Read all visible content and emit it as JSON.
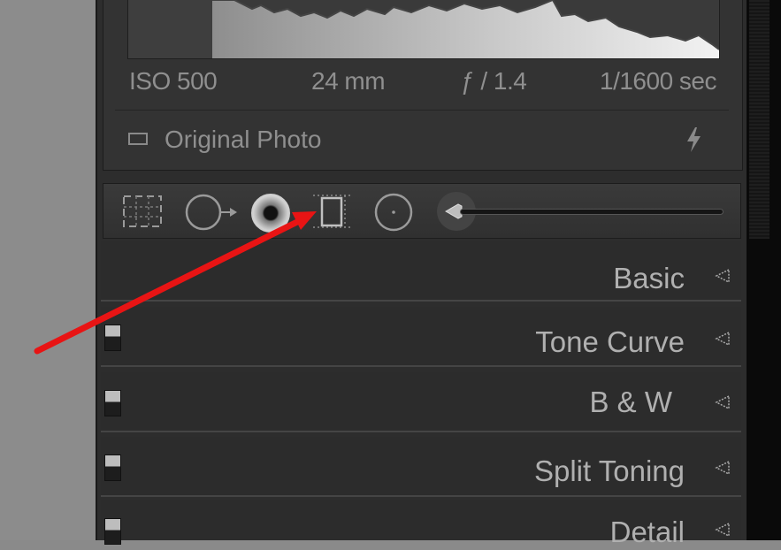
{
  "histogram": {
    "exif": {
      "iso": "ISO 500",
      "focal_length": "24 mm",
      "aperture": "ƒ / 1.4",
      "shutter": "1/1600 sec"
    },
    "original_photo_label": "Original Photo",
    "icons": {
      "original": "rectangle-outline-icon",
      "flash": "lightning-bolt-icon"
    }
  },
  "toolstrip": {
    "tools": [
      {
        "name": "crop-overlay-tool",
        "icon": "crop-grid-icon"
      },
      {
        "name": "spot-removal-tool",
        "icon": "circle-arrow-icon"
      },
      {
        "name": "red-eye-tool",
        "icon": "eye-icon"
      },
      {
        "name": "graduated-filter-tool",
        "icon": "graduated-rectangle-icon"
      },
      {
        "name": "radial-filter-tool",
        "icon": "radial-circle-icon"
      },
      {
        "name": "adjustment-brush-tool",
        "icon": "brush-icon"
      }
    ],
    "highlighted_tool": "graduated-filter-tool"
  },
  "panels": [
    {
      "title": "Basic",
      "has_switch": false
    },
    {
      "title": "Tone Curve",
      "has_switch": true
    },
    {
      "title": "B & W",
      "has_switch": true
    },
    {
      "title": "Split Toning",
      "has_switch": true
    },
    {
      "title": "Detail",
      "has_switch": true
    }
  ],
  "annotation": {
    "type": "red-arrow",
    "color": "#e81414"
  },
  "colors": {
    "panel_bg": "#2d2d2d",
    "text": "#b0b0b0",
    "accent_arrow": "#e81414"
  }
}
